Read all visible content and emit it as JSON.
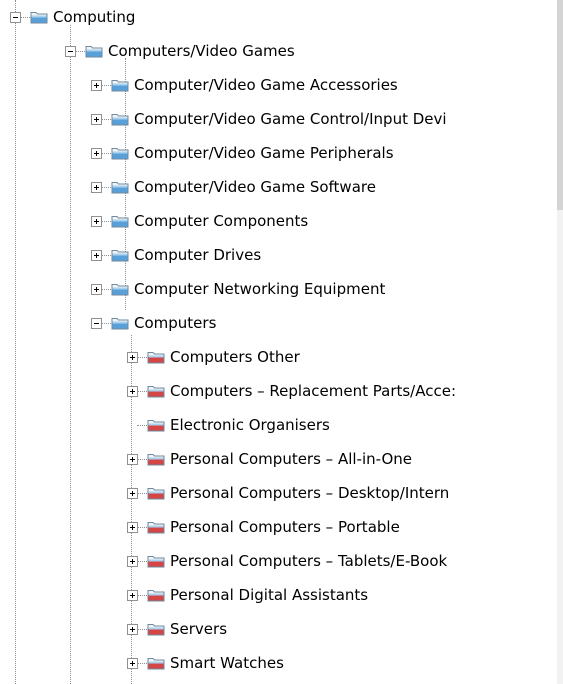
{
  "tree": {
    "root": {
      "label": "Computing",
      "expanded": true
    },
    "level1": {
      "label": "Computers/Video Games",
      "expanded": true
    },
    "level2_items": [
      {
        "label": "Computer/Video Game Accessories",
        "expanded": false
      },
      {
        "label": "Computer/Video Game Control/Input Devi",
        "expanded": false
      },
      {
        "label": "Computer/Video Game Peripherals",
        "expanded": false
      },
      {
        "label": "Computer/Video Game Software",
        "expanded": false
      },
      {
        "label": "Computer Components",
        "expanded": false
      },
      {
        "label": "Computer Drives",
        "expanded": false
      },
      {
        "label": "Computer Networking Equipment",
        "expanded": false
      },
      {
        "label": "Computers",
        "expanded": true
      }
    ],
    "level3_items": [
      {
        "label": "Computers Other",
        "expanded": false,
        "has_children": true
      },
      {
        "label": "Computers – Replacement Parts/Acce:",
        "expanded": false,
        "has_children": true
      },
      {
        "label": "Electronic Organisers",
        "expanded": false,
        "has_children": false
      },
      {
        "label": "Personal Computers – All-in-One",
        "expanded": false,
        "has_children": true
      },
      {
        "label": "Personal Computers – Desktop/Intern",
        "expanded": false,
        "has_children": true
      },
      {
        "label": "Personal Computers – Portable",
        "expanded": false,
        "has_children": true
      },
      {
        "label": "Personal Computers  – Tablets/E-Book",
        "expanded": false,
        "has_children": true
      },
      {
        "label": "Personal Digital Assistants",
        "expanded": false,
        "has_children": true
      },
      {
        "label": "Servers",
        "expanded": false,
        "has_children": true
      },
      {
        "label": "Smart Watches",
        "expanded": false,
        "has_children": true
      }
    ]
  },
  "icons": {
    "folder": "folder-icon",
    "folder_leaf": "folder-leaf-icon",
    "expand": "plus-icon",
    "collapse": "minus-icon"
  },
  "colors": {
    "folder_blue": "#5aa0d8",
    "folder_light": "#a9d2f0",
    "folder_leaf_red": "#d64545",
    "guide_line": "#8f8f8f",
    "text": "#000000",
    "background": "#ffffff"
  }
}
